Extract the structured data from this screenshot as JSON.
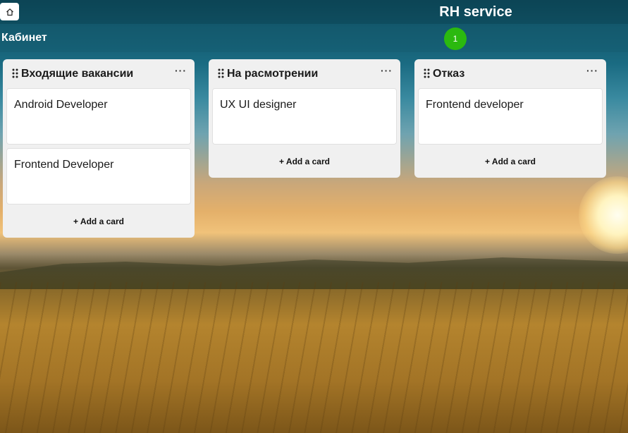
{
  "header": {
    "home_icon": "home-icon",
    "app_title": "RH service"
  },
  "subheader": {
    "board_title": "Кабинет",
    "badge_count": "1",
    "badge_color": "#2bb90f"
  },
  "lists": [
    {
      "title": "Входящие вакансии",
      "menu": "···",
      "cards": [
        "Android Developer",
        "Frontend Developer"
      ],
      "add_label": "+ Add a card"
    },
    {
      "title": "На расмотрении",
      "menu": "···",
      "cards": [
        "UX UI designer"
      ],
      "add_label": "+ Add a card"
    },
    {
      "title": "Отказ",
      "menu": "···",
      "cards": [
        "Frontend developer"
      ],
      "add_label": "+ Add a card"
    }
  ]
}
